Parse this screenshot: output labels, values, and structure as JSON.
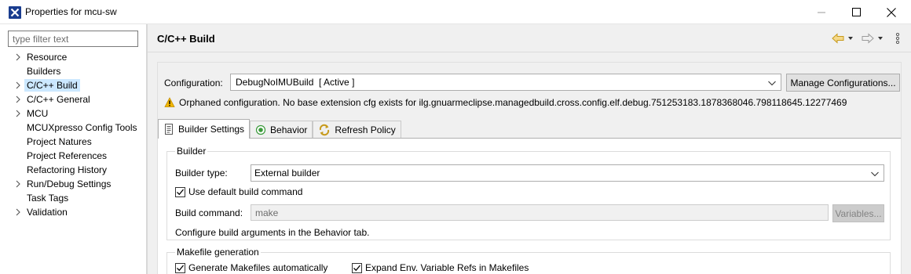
{
  "window": {
    "title": "Properties for mcu-sw",
    "controls": {
      "minimize_icon": "minimize-icon",
      "maximize_icon": "maximize-icon",
      "close_icon": "close-icon"
    }
  },
  "filter": {
    "placeholder": "type filter text",
    "value": ""
  },
  "tree": [
    {
      "label": "Resource",
      "expandable": true,
      "selected": false
    },
    {
      "label": "Builders",
      "expandable": false,
      "selected": false
    },
    {
      "label": "C/C++ Build",
      "expandable": true,
      "selected": true
    },
    {
      "label": "C/C++ General",
      "expandable": true,
      "selected": false
    },
    {
      "label": "MCU",
      "expandable": true,
      "selected": false
    },
    {
      "label": "MCUXpresso Config Tools",
      "expandable": false,
      "selected": false
    },
    {
      "label": "Project Natures",
      "expandable": false,
      "selected": false
    },
    {
      "label": "Project References",
      "expandable": false,
      "selected": false
    },
    {
      "label": "Refactoring History",
      "expandable": false,
      "selected": false
    },
    {
      "label": "Run/Debug Settings",
      "expandable": true,
      "selected": false
    },
    {
      "label": "Task Tags",
      "expandable": false,
      "selected": false
    },
    {
      "label": "Validation",
      "expandable": true,
      "selected": false
    }
  ],
  "page": {
    "title": "C/C++ Build",
    "nav": {
      "back_icon": "back-arrow-icon",
      "forward_icon": "forward-arrow-icon",
      "menu_icon": "more-vertical-icon"
    }
  },
  "configuration": {
    "label": "Configuration:",
    "value": "DebugNoIMUBuild  [ Active ]",
    "manage_button": "Manage Configurations...",
    "warning": "Orphaned configuration. No base extension cfg exists for ilg.gnuarmeclipse.managedbuild.cross.config.elf.debug.751253183.1878368046.798118645.12277469"
  },
  "tabs": [
    {
      "label": "Builder Settings",
      "icon": "builder-settings-icon",
      "active": true
    },
    {
      "label": "Behavior",
      "icon": "behavior-icon",
      "active": false
    },
    {
      "label": "Refresh Policy",
      "icon": "refresh-policy-icon",
      "active": false
    }
  ],
  "builder": {
    "group_title": "Builder",
    "type_label": "Builder type:",
    "type_value": "External builder",
    "use_default_label": "Use default build command",
    "use_default_checked": true,
    "command_label": "Build command:",
    "command_value": "make",
    "variables_button": "Variables...",
    "note": "Configure build arguments in the Behavior tab."
  },
  "makefile": {
    "group_title": "Makefile generation",
    "generate_label": "Generate Makefiles automatically",
    "generate_checked": true,
    "expand_label": "Expand Env. Variable Refs in Makefiles",
    "expand_checked": true
  },
  "colors": {
    "selection": "#cce8ff",
    "accent": "#1a3d8f",
    "warning": "#e8a600"
  }
}
